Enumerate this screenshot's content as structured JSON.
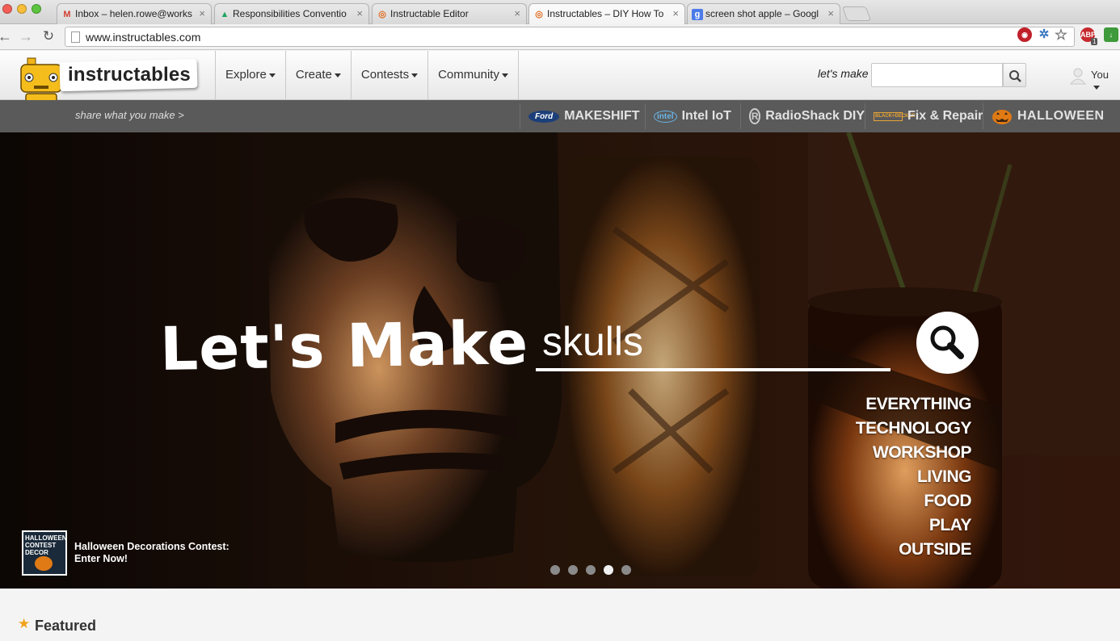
{
  "browser": {
    "tabs": [
      {
        "label": "Inbox – helen.rowe@works",
        "favicon": "gmail-icon"
      },
      {
        "label": "Responsibilities Conventio",
        "favicon": "drive-icon"
      },
      {
        "label": "Instructable Editor",
        "favicon": "instructables-icon"
      },
      {
        "label": "Instructables – DIY How To",
        "favicon": "instructables-icon",
        "active": true
      },
      {
        "label": "screen shot apple – Googl",
        "favicon": "google-icon"
      }
    ],
    "url": "www.instructables.com",
    "abp_count": "1"
  },
  "header": {
    "logo_text": "instructables",
    "tagline": "share what you make >",
    "nav": [
      {
        "label": "Explore"
      },
      {
        "label": "Create"
      },
      {
        "label": "Contests"
      },
      {
        "label": "Community"
      }
    ],
    "search_label": "let's make",
    "search_placeholder": "",
    "user_label": "You"
  },
  "channels": [
    {
      "label": "MAKESHIFT",
      "badge": "Ford"
    },
    {
      "label": "Intel IoT",
      "badge": "intel"
    },
    {
      "label": "RadioShack DIY",
      "badge": "R"
    },
    {
      "label": "Fix & Repair",
      "badge": "BLACK+DECKER"
    },
    {
      "label": "HALLOWEEN",
      "badge": "jack-o-lantern"
    }
  ],
  "hero": {
    "heading": "Let's Make",
    "search_value": "skulls",
    "categories": [
      "EVERYTHING",
      "TECHNOLOGY",
      "WORKSHOP",
      "LIVING",
      "FOOD",
      "PLAY",
      "OUTSIDE"
    ],
    "contest": {
      "thumb_text": "HALLOWEEN CONTEST DECOR",
      "line1": "Halloween Decorations Contest:",
      "line2": "Enter Now!"
    },
    "slides": 5,
    "active_slide": 4
  },
  "featured": {
    "title": "Featured"
  },
  "colors": {
    "accent": "#f0a21a",
    "subbar": "#5a5a5a"
  }
}
